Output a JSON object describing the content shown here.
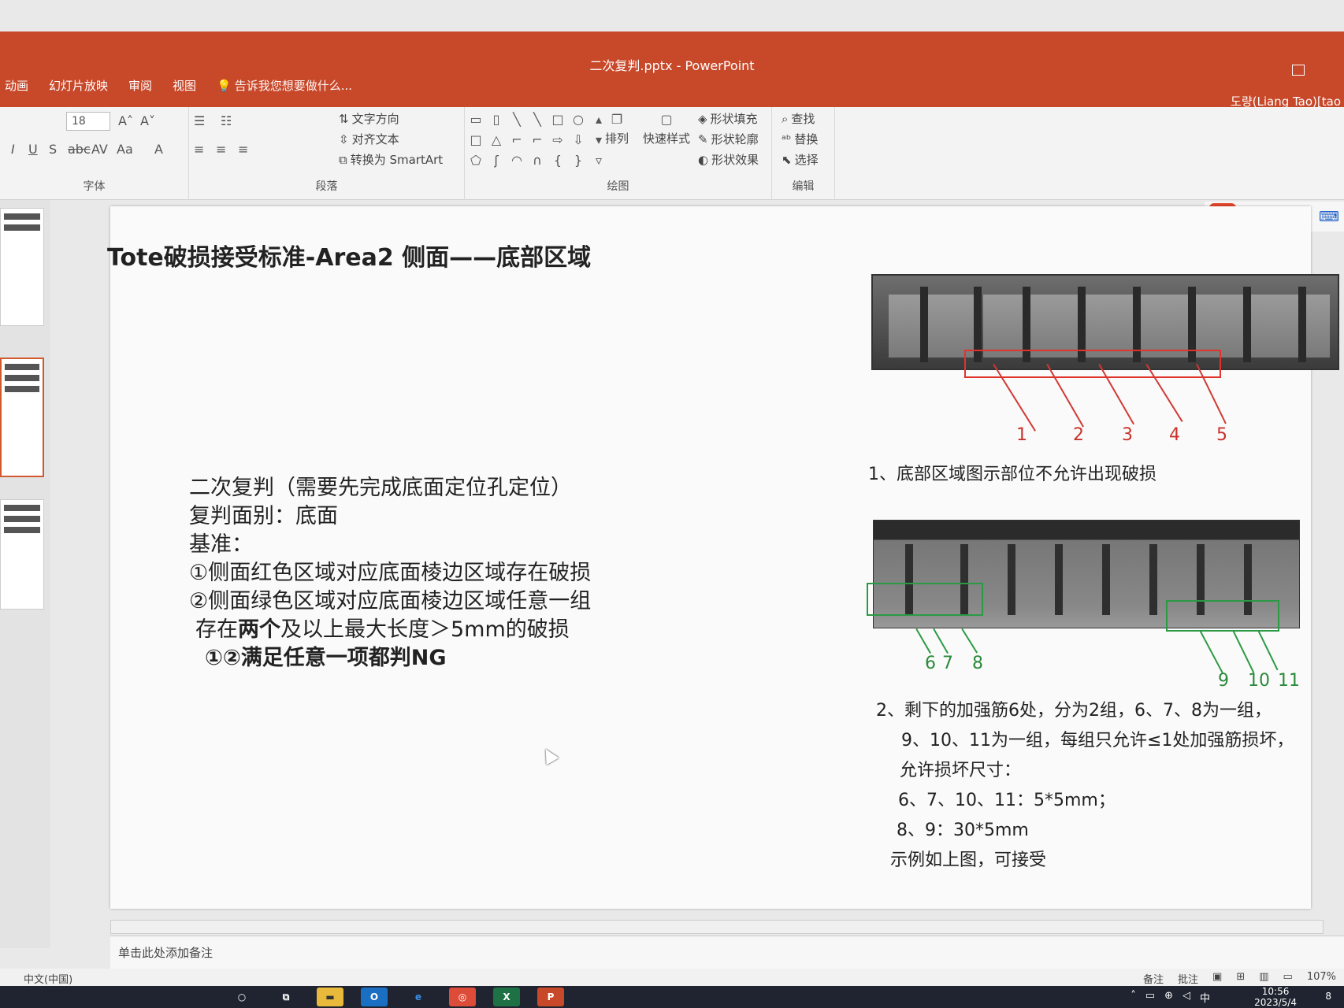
{
  "app": {
    "window_title": "二次复判.pptx - PowerPoint",
    "user": "도량(Liang Tao)[tao"
  },
  "menu": {
    "items": [
      "动画",
      "幻灯片放映",
      "审阅",
      "视图"
    ],
    "tell_me": "告诉我您想要做什么..."
  },
  "ribbon": {
    "font_size": "18",
    "groups": {
      "font": "字体",
      "paragraph": "段落",
      "drawing": "绘图",
      "editing": "编辑"
    },
    "text_direction": "文字方向",
    "align_text": "对齐文本",
    "convert_smartart": "转换为 SmartArt",
    "arrange": "排列",
    "quick_styles": "快速样式",
    "shape_fill": "形状填充",
    "shape_outline": "形状轮廓",
    "shape_effects": "形状效果",
    "find": "查找",
    "replace": "替换",
    "select": "选择"
  },
  "ime": {
    "logo": "S",
    "mode": "中",
    "punct": "•,",
    "mic": "🎤",
    "keyboard": "⌨"
  },
  "slide": {
    "title": "Tote破损接受标准-Area2 侧面——底部区域",
    "criteria": {
      "line1": "二次复判（需要先完成底面定位孔定位）",
      "line2": "复判面别：底面",
      "line3": "基准：",
      "line4": "①侧面红色区域对应底面棱边区域存在破损",
      "line5": "②侧面绿色区域对应底面棱边区域任意一组",
      "line6_pre": "存在",
      "line6_bold": "两个",
      "line6_post": "及以上最大长度＞5mm的破损",
      "line7": "①②满足任意一项都判NG"
    },
    "red_labels": [
      "1",
      "2",
      "3",
      "4",
      "5"
    ],
    "note1": "1、底部区域图示部位不允许出现破损",
    "green_labels_a": [
      "6",
      "7",
      "8"
    ],
    "green_labels_b": [
      "9",
      "10",
      "11"
    ],
    "note2_lines": [
      "2、剩下的加强筋6处，分为2组，6、7、8为一组，",
      "9、10、11为一组，每组只允许≤1处加强筋损坏，",
      "允许损坏尺寸：",
      "6、7、10、11：5*5mm；",
      "8、9：30*5mm",
      "示例如上图，可接受"
    ]
  },
  "notes": {
    "placeholder": "单击此处添加备注"
  },
  "status": {
    "language": "中文(中国)",
    "notes_btn": "备注",
    "comments_btn": "批注",
    "zoom": "107%"
  },
  "taskbar": {
    "time": "10:56",
    "date": "2023/5/4",
    "ime_indicator": "中",
    "notification_count": "8"
  },
  "colors": {
    "titlebar": "#c8482a",
    "red_mark": "#e0332b",
    "green_mark": "#2b9a44"
  }
}
